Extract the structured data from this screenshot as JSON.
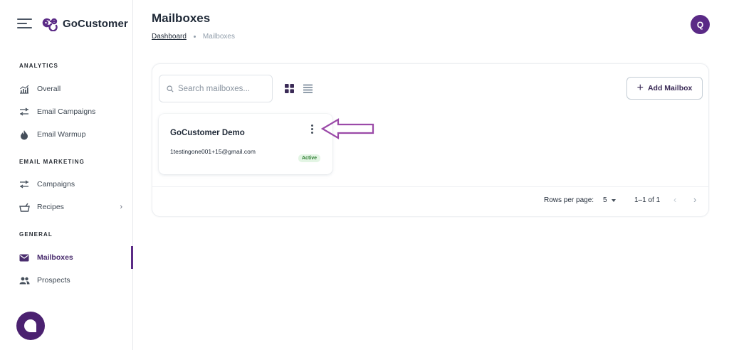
{
  "app": {
    "name": "GoCustomer"
  },
  "sidebar": {
    "sections": [
      {
        "title": "ANALYTICS",
        "items": [
          {
            "label": "Overall",
            "icon": "chart-icon"
          },
          {
            "label": "Email Campaigns",
            "icon": "campaign-icon"
          },
          {
            "label": "Email Warmup",
            "icon": "fire-icon"
          }
        ]
      },
      {
        "title": "EMAIL MARKETING",
        "items": [
          {
            "label": "Campaigns",
            "icon": "campaign-icon"
          },
          {
            "label": "Recipes",
            "icon": "basket-icon",
            "has_submenu": true
          }
        ]
      },
      {
        "title": "GENERAL",
        "items": [
          {
            "label": "Mailboxes",
            "icon": "mail-icon",
            "active": true
          },
          {
            "label": "Prospects",
            "icon": "people-icon"
          }
        ]
      }
    ]
  },
  "header": {
    "title": "Mailboxes",
    "breadcrumb": {
      "link": "Dashboard",
      "current": "Mailboxes"
    },
    "avatar_initial": "Q"
  },
  "toolbar": {
    "search_placeholder": "Search mailboxes...",
    "add_label": "Add Mailbox"
  },
  "mailboxes": [
    {
      "name": "GoCustomer Demo",
      "email": "1testingone001+15@gmail.com",
      "status": "Active"
    }
  ],
  "pagination": {
    "rows_label": "Rows per page:",
    "rows_value": "5",
    "range": "1–1 of 1"
  },
  "colors": {
    "accent": "#5b2b86",
    "chat": "#4b2170",
    "active_badge_bg": "#e3f5e4",
    "active_badge_text": "#2e7d32",
    "annotation_arrow": "#9b4aa8"
  }
}
